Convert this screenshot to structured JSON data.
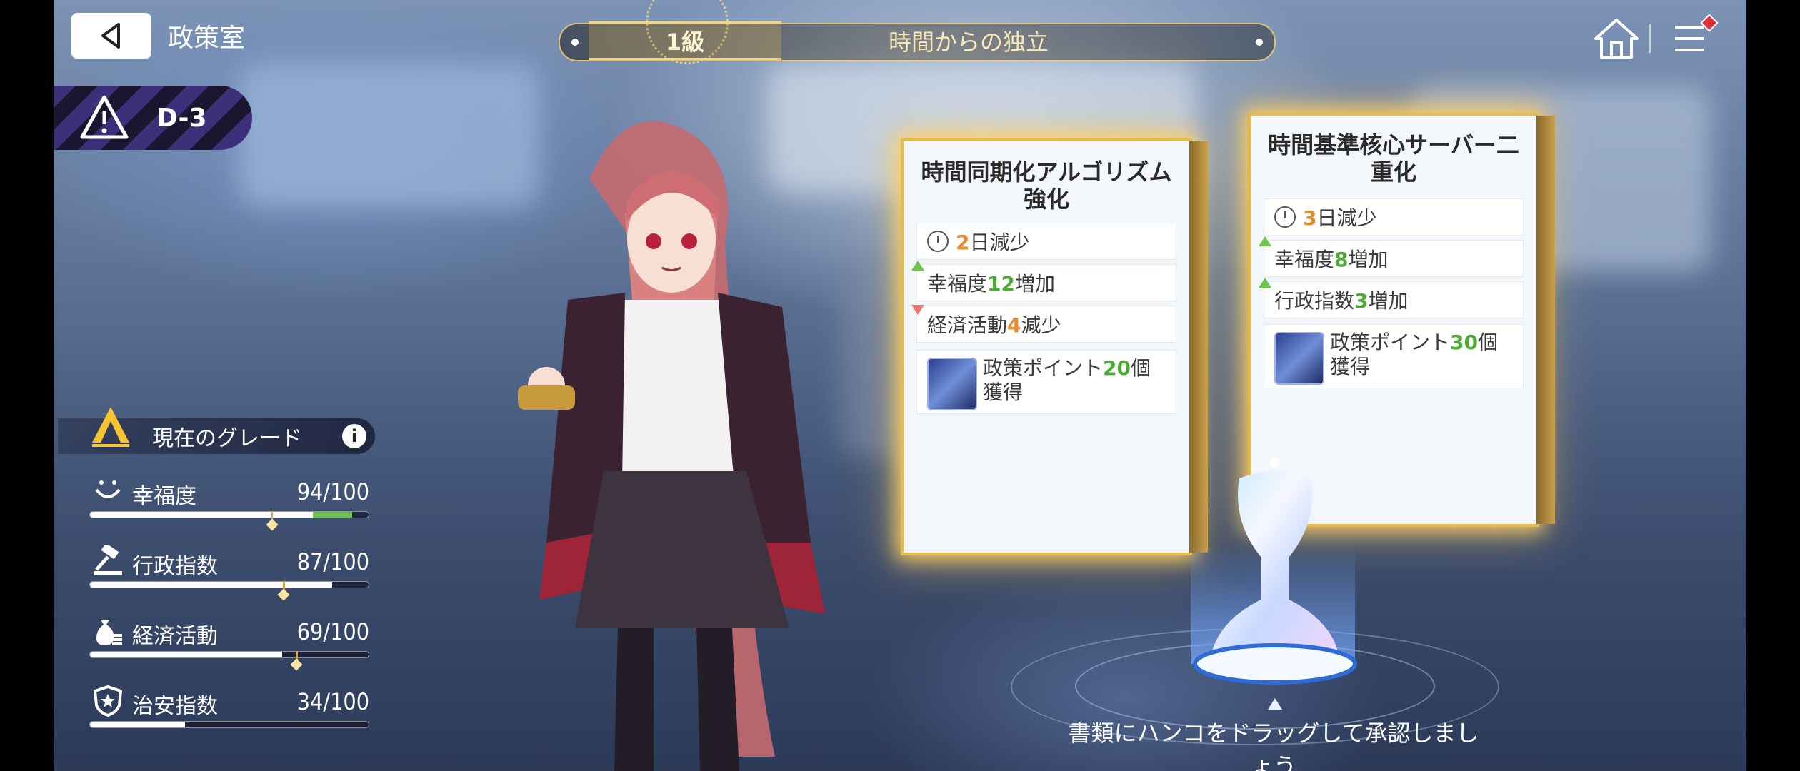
{
  "header": {
    "back_icon": "back-arrow-icon",
    "title": "政策室",
    "home_icon": "home-icon",
    "menu_icon": "menu-icon"
  },
  "stage": {
    "grade": "1級",
    "name": "時間からの独立"
  },
  "difficulty": {
    "icon": "warning-icon",
    "label": "D-3"
  },
  "grade_panel": {
    "label": "現在のグレード",
    "grade_letter": "A",
    "info_icon": "info-icon"
  },
  "stats": [
    {
      "name": "幸福度",
      "value": "94/100",
      "ratio": 0.94,
      "icon": "smile-icon",
      "color": "#6fc24f"
    },
    {
      "name": "行政指数",
      "value": "87/100",
      "ratio": 0.87,
      "icon": "gavel-icon",
      "color": "#ffffff"
    },
    {
      "name": "経済活動",
      "value": "69/100",
      "ratio": 0.69,
      "icon": "money-bag-icon",
      "color": "#ffffff"
    },
    {
      "name": "治安指数",
      "value": "34/100",
      "ratio": 0.34,
      "icon": "police-badge-icon",
      "color": "#ffffff"
    }
  ],
  "cards": [
    {
      "title": "時間同期化アルゴリズム強化",
      "time": {
        "num": "2",
        "text": "日減少"
      },
      "effects": [
        {
          "prefix": "幸福度",
          "num": "12",
          "suffix": "増加",
          "dir": "up"
        },
        {
          "prefix": "経済活動",
          "num": "4",
          "suffix": "減少",
          "dir": "down"
        }
      ],
      "reward": {
        "prefix": "政策ポイント",
        "num": "20",
        "suffix": "個獲得"
      }
    },
    {
      "title": "時間基準核心サーバー二重化",
      "time": {
        "num": "3",
        "text": "日減少"
      },
      "effects": [
        {
          "prefix": "幸福度",
          "num": "8",
          "suffix": "増加",
          "dir": "up"
        },
        {
          "prefix": "行政指数",
          "num": "3",
          "suffix": "増加",
          "dir": "up"
        }
      ],
      "reward": {
        "prefix": "政策ポイント",
        "num": "30",
        "suffix": "個獲得"
      }
    }
  ],
  "hint": "書類にハンコをドラッグして承認しましょう",
  "colors": {
    "accent_gold": "#e8b94c",
    "increase": "#4caa35",
    "number_orange": "#e58a2f",
    "decrease_arrow": "#f0776a"
  }
}
